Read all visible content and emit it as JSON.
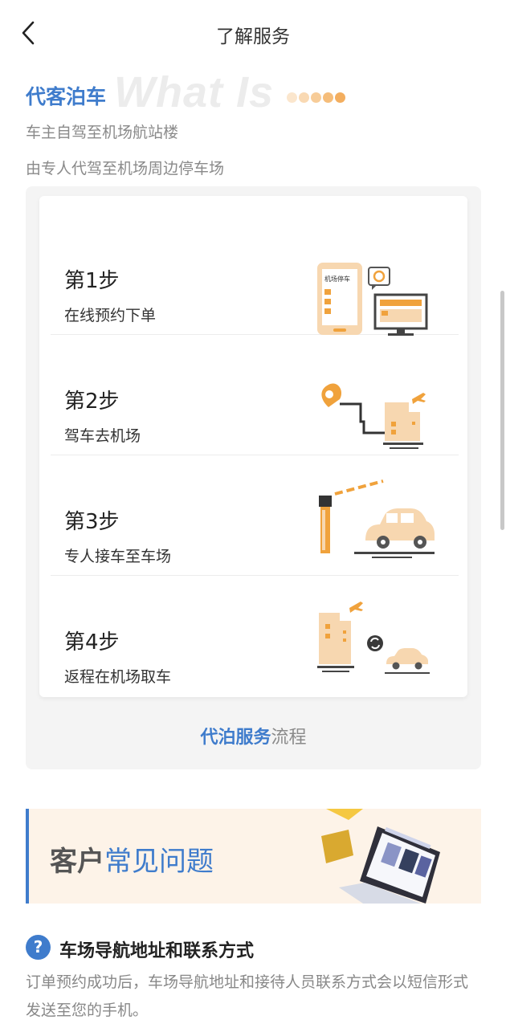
{
  "nav": {
    "title": "了解服务",
    "back_icon": "chevron-left-icon"
  },
  "intro": {
    "title": "代客泊车",
    "watermark": "What Is",
    "lines": [
      "车主自驾至机场航站楼",
      "由专人代驾至机场周边停车场"
    ]
  },
  "steps": [
    {
      "title": "第1步",
      "desc": "在线预约下单",
      "illustration": "phone-booking-icon",
      "illustration_text": "机场停车"
    },
    {
      "title": "第2步",
      "desc": "驾车去机场",
      "illustration": "route-to-airport-icon"
    },
    {
      "title": "第3步",
      "desc": "专人接车至车场",
      "illustration": "parking-gate-car-icon"
    },
    {
      "title": "第4步",
      "desc": "返程在机场取车",
      "illustration": "return-pickup-icon"
    }
  ],
  "process": {
    "highlight": "代泊服务",
    "rest": "流程"
  },
  "faq": {
    "banner_prefix": "客户",
    "banner_highlight": "常见问题",
    "question": "车场导航地址和联系方式",
    "question_icon": "question-mark-icon",
    "answer": "订单预约成功后，车场导航地址和接待人员联系方式会以短信形式发送至您的手机。"
  },
  "colors": {
    "accent": "#3f7ccc",
    "orange": "#f0a23c",
    "peach": "#f7d7b0",
    "panel": "#f4f4f4"
  }
}
